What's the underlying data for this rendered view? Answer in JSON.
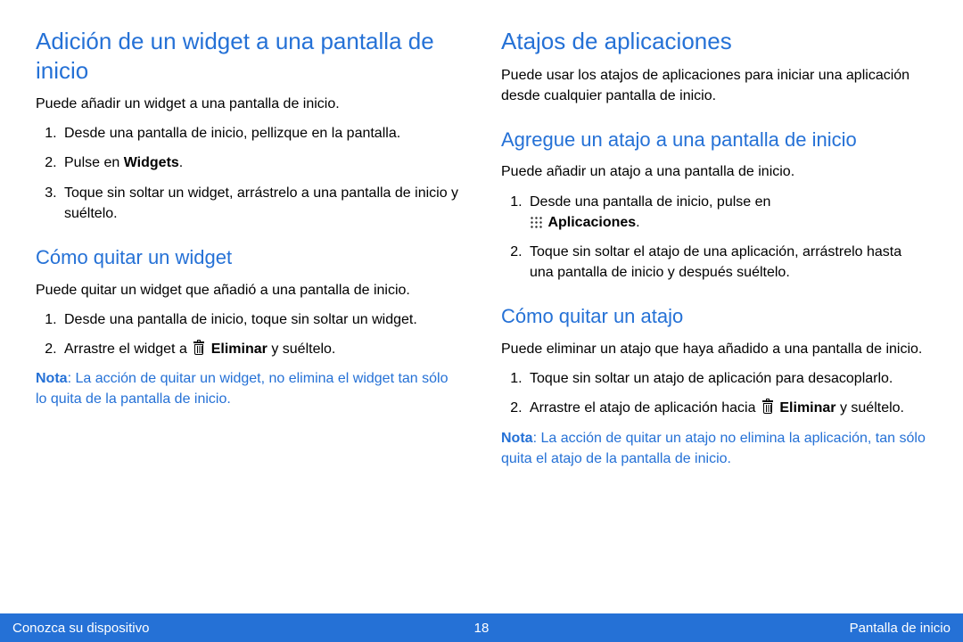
{
  "left": {
    "h1": "Adición de un widget a una pantalla de inicio",
    "p1": "Puede añadir un widget a una pantalla de inicio.",
    "li1": "Desde una pantalla de inicio, pellizque en la pantalla.",
    "li2a": "Pulse en ",
    "li2b": "Widgets",
    "li2c": ".",
    "li3": "Toque sin soltar un widget, arrástrelo a una pantalla de inicio y suéltelo.",
    "h2": "Cómo quitar un widget",
    "p2": "Puede quitar un widget que añadió a una pantalla de inicio.",
    "r_li1": "Desde una pantalla de inicio, toque sin soltar un widget.",
    "r_li2a": "Arrastre el widget a ",
    "r_li2b": "Eliminar",
    "r_li2c": " y suéltelo.",
    "note_label": "Nota",
    "note": ": La acción de quitar un widget, no elimina el widget tan sólo lo quita de la pantalla de inicio."
  },
  "right": {
    "h1": "Atajos de aplicaciones",
    "p1": "Puede usar los atajos de aplicaciones para iniciar una aplicación desde cualquier pantalla de inicio.",
    "h2a": "Agregue un atajo a una pantalla de inicio",
    "p2": "Puede añadir un atajo a una pantalla de inicio.",
    "a_li1a": "Desde una pantalla de inicio, pulse en",
    "a_li1b": "Aplicaciones",
    "a_li1c": ".",
    "a_li2": "Toque sin soltar el atajo de una aplicación, arrástrelo hasta una pantalla de inicio y después suéltelo.",
    "h2b": "Cómo quitar un atajo",
    "p3": "Puede eliminar un atajo que haya añadido a una pantalla de inicio.",
    "b_li1": "Toque sin soltar un atajo de aplicación para desacoplarlo.",
    "b_li2a": "Arrastre el atajo de aplicación hacia ",
    "b_li2b": "Eliminar",
    "b_li2c": " y suéltelo.",
    "note_label": "Nota",
    "note": ": La acción de quitar un atajo no elimina la aplicación, tan sólo quita el atajo de la pantalla de inicio."
  },
  "footer": {
    "left": "Conozca su dispositivo",
    "center": "18",
    "right": "Pantalla de inicio"
  }
}
